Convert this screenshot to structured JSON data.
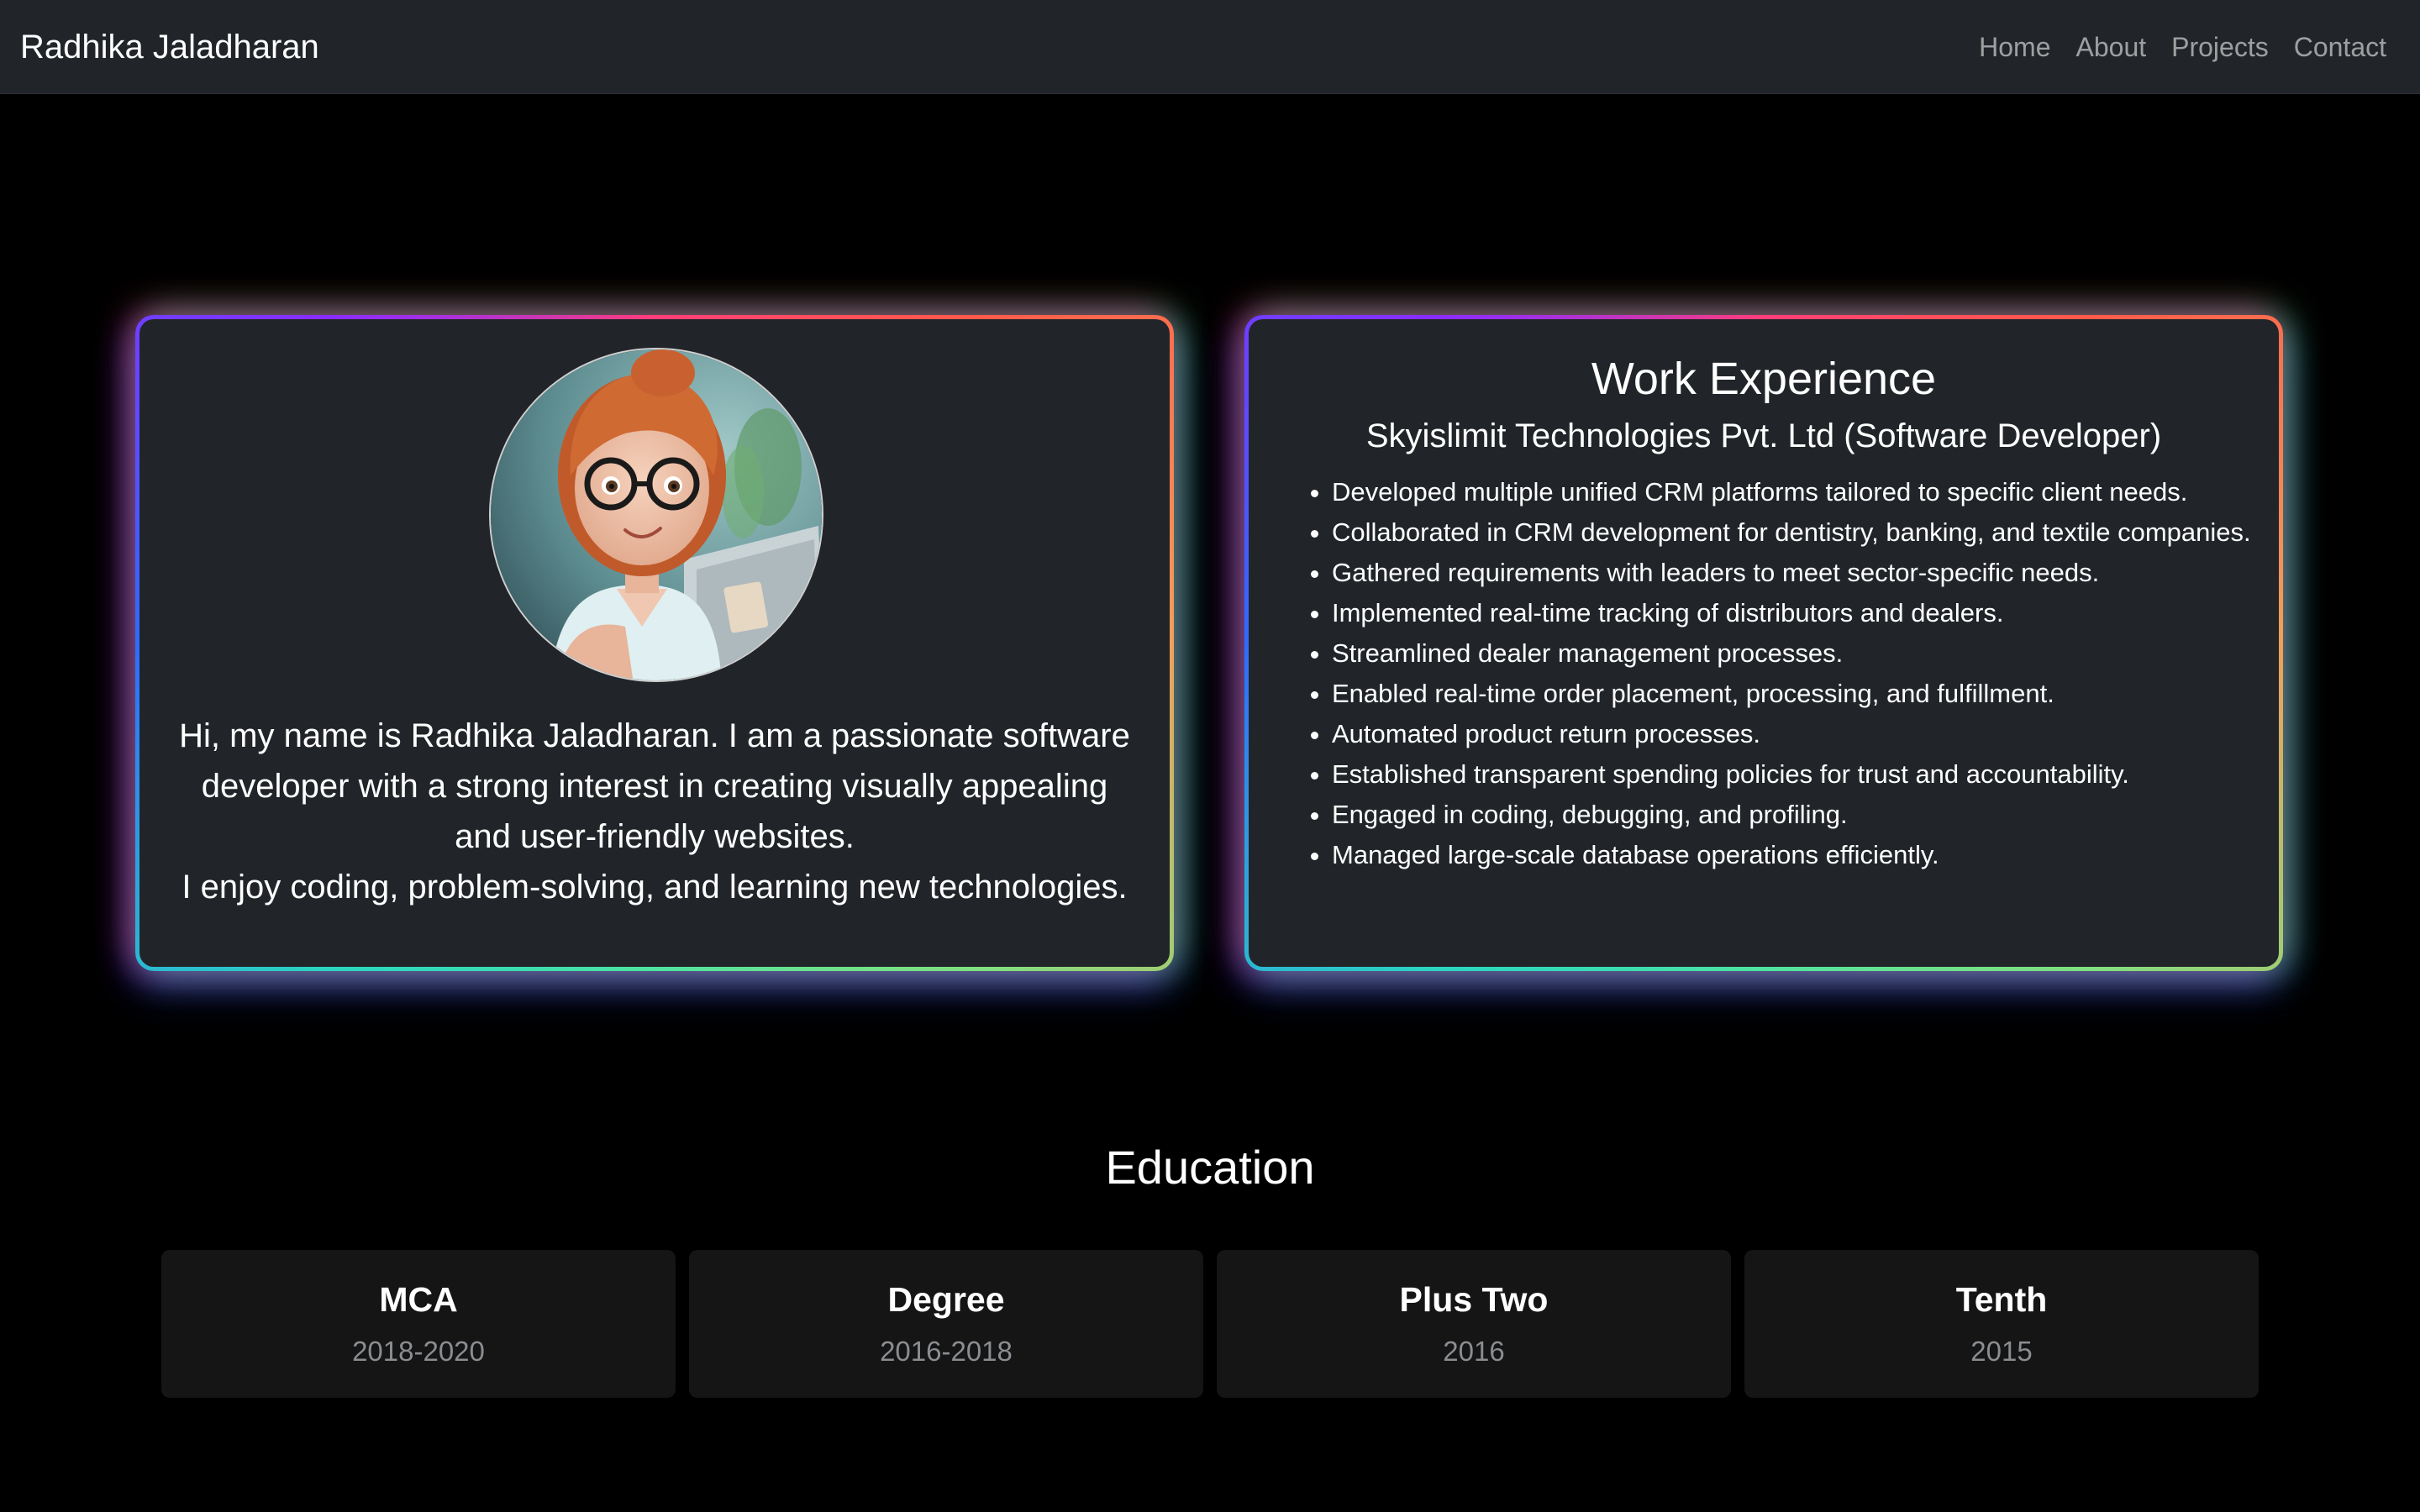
{
  "navbar": {
    "brand": "Radhika Jaladharan",
    "links": [
      "Home",
      "About",
      "Projects",
      "Contact"
    ]
  },
  "about": {
    "intro": "Hi, my name is Radhika Jaladharan. I am a passionate software developer with a strong interest in creating visually appealing and user-friendly websites.",
    "hobbies": "I enjoy coding, problem-solving, and learning new technologies."
  },
  "work": {
    "title": "Work Experience",
    "company": "Skyislimit Technologies Pvt. Ltd (Software Developer)",
    "points": [
      "Developed multiple unified CRM platforms tailored to specific client needs.",
      "Collaborated in CRM development for dentistry, banking, and textile companies.",
      "Gathered requirements with leaders to meet sector-specific needs.",
      "Implemented real-time tracking of distributors and dealers.",
      "Streamlined dealer management processes.",
      "Enabled real-time order placement, processing, and fulfillment.",
      "Automated product return processes.",
      "Established transparent spending policies for trust and accountability.",
      "Engaged in coding, debugging, and profiling.",
      "Managed large-scale database operations efficiently."
    ]
  },
  "education": {
    "heading": "Education",
    "items": [
      {
        "title": "MCA",
        "years": "2018-2020"
      },
      {
        "title": "Degree",
        "years": "2016-2018"
      },
      {
        "title": "Plus Two",
        "years": "2016"
      },
      {
        "title": "Tenth",
        "years": "2015"
      }
    ]
  },
  "icons": {
    "avatar": "profile-avatar-illustration"
  },
  "colors": {
    "page_background": "#000000",
    "navbar_background": "#212529",
    "card_background": "#212529",
    "education_card_background": "#151515",
    "muted_text": "#8a8d91"
  }
}
